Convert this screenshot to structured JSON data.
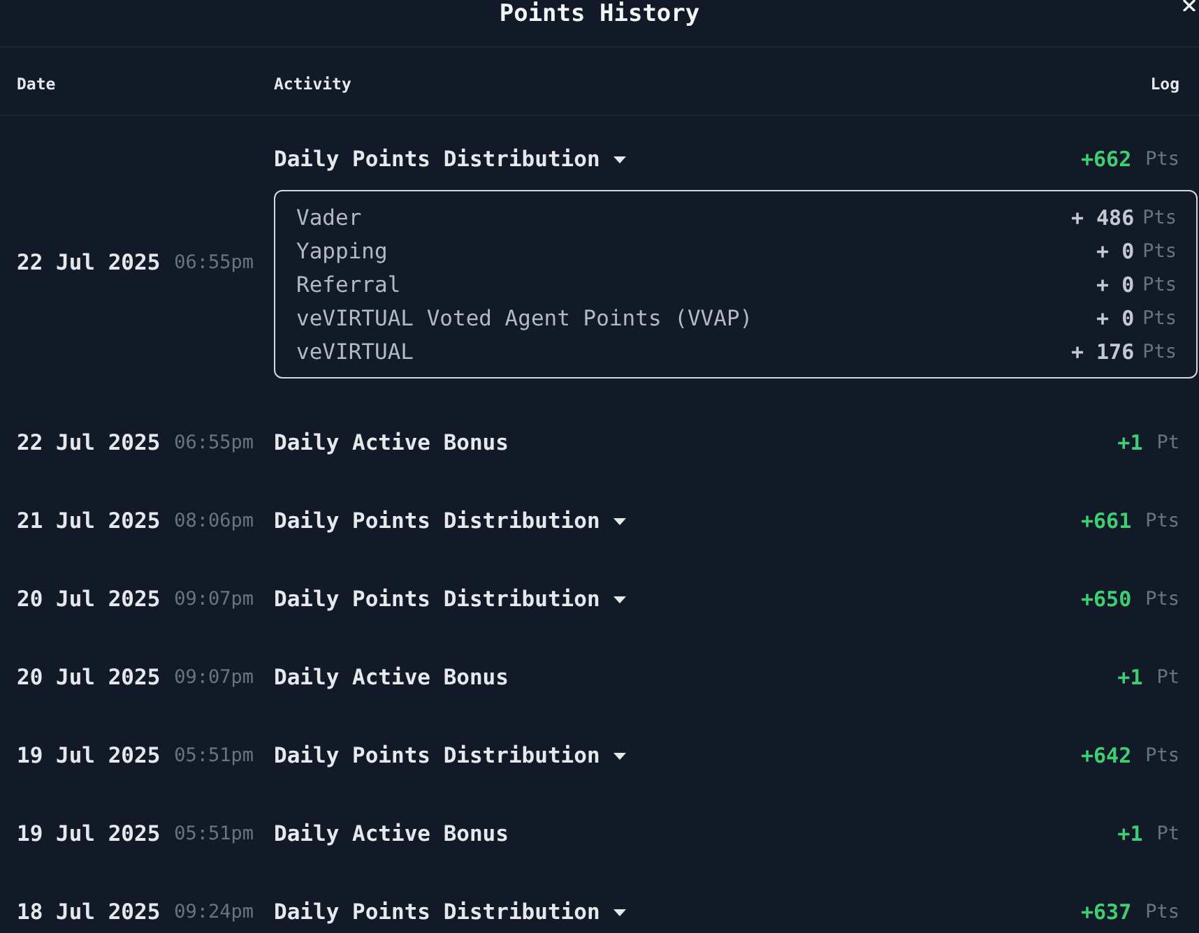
{
  "title": "Points History",
  "table": {
    "columns": [
      "Date",
      "Activity",
      "Log"
    ],
    "rows": [
      {
        "date": "22 Jul 2025",
        "time": "06:55pm",
        "activity": "Daily Points Distribution",
        "kind": "dropdown",
        "points": "+662",
        "unit": "Pts",
        "breakdown": [
          {
            "label": "Vader",
            "points": "+ 486",
            "unit": "Pts"
          },
          {
            "label": "Yapping",
            "points": "+ 0",
            "unit": "Pts"
          },
          {
            "label": "Referral",
            "points": "+ 0",
            "unit": "Pts"
          },
          {
            "label": "veVIRTUAL Voted Agent Points (VVAP)",
            "points": "+ 0",
            "unit": "Pts"
          },
          {
            "label": "veVIRTUAL",
            "points": "+ 176",
            "unit": "Pts"
          }
        ]
      },
      {
        "date": "22 Jul 2025",
        "time": "06:55pm",
        "activity": "Daily Active Bonus",
        "kind": "plain",
        "points": "+1",
        "unit": "Pt"
      },
      {
        "date": "21 Jul 2025",
        "time": "08:06pm",
        "activity": "Daily Points Distribution",
        "kind": "dropdown",
        "points": "+661",
        "unit": "Pts"
      },
      {
        "date": "20 Jul 2025",
        "time": "09:07pm",
        "activity": "Daily Points Distribution",
        "kind": "dropdown",
        "points": "+650",
        "unit": "Pts"
      },
      {
        "date": "20 Jul 2025",
        "time": "09:07pm",
        "activity": "Daily Active Bonus",
        "kind": "plain",
        "points": "+1",
        "unit": "Pt"
      },
      {
        "date": "19 Jul 2025",
        "time": "05:51pm",
        "activity": "Daily Points Distribution",
        "kind": "dropdown",
        "points": "+642",
        "unit": "Pts"
      },
      {
        "date": "19 Jul 2025",
        "time": "05:51pm",
        "activity": "Daily Active Bonus",
        "kind": "plain",
        "points": "+1",
        "unit": "Pt"
      },
      {
        "date": "18 Jul 2025",
        "time": "09:24pm",
        "activity": "Daily Points Distribution",
        "kind": "dropdown",
        "points": "+637",
        "unit": "Pts"
      }
    ]
  }
}
